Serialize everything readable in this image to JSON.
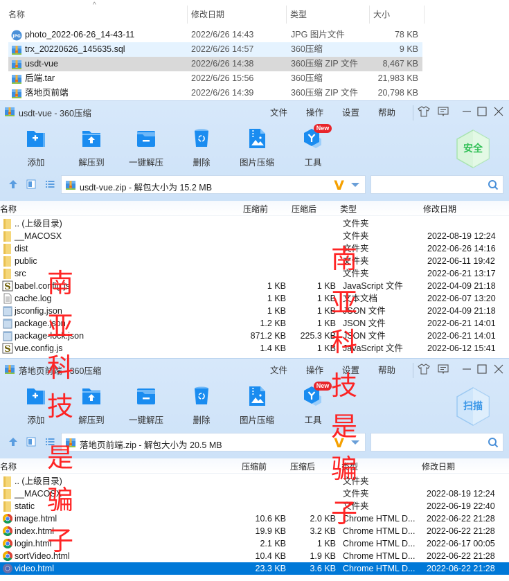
{
  "explorer": {
    "columns": {
      "name": "名称",
      "date": "修改日期",
      "type": "类型",
      "size": "大小"
    },
    "files": [
      {
        "name": "photo_2022-06-26_14-43-11",
        "date": "2022/6/26 14:43",
        "type": "JPG 图片文件",
        "size": "78 KB",
        "icon": "jpg-icon",
        "state": "normal"
      },
      {
        "name": "trx_20220626_145635.sql",
        "date": "2022/6/26 14:57",
        "type": "360压缩",
        "size": "9 KB",
        "icon": "archive-icon",
        "state": "hover"
      },
      {
        "name": "usdt-vue",
        "date": "2022/6/26 14:38",
        "type": "360压缩 ZIP 文件",
        "size": "8,467 KB",
        "icon": "archive-icon",
        "state": "selected"
      },
      {
        "name": "后端.tar",
        "date": "2022/6/26 15:56",
        "type": "360压缩",
        "size": "21,983 KB",
        "icon": "archive-icon",
        "state": "normal"
      },
      {
        "name": "落地页前端",
        "date": "2022/6/26 14:39",
        "type": "360压缩 ZIP 文件",
        "size": "20,798 KB",
        "icon": "archive-icon",
        "state": "normal"
      }
    ]
  },
  "window1": {
    "title": "usdt-vue - 360压缩",
    "menu": [
      "文件",
      "操作",
      "设置",
      "帮助"
    ],
    "toolbar": [
      "添加",
      "解压到",
      "一键解压",
      "删除",
      "图片压缩",
      "工具"
    ],
    "new_badge": "New",
    "shield_label": "安全",
    "address": "usdt-vue.zip - 解包大小为 15.2 MB",
    "search_value": "",
    "columns": {
      "name": "名称",
      "before": "压缩前",
      "after": "压缩后",
      "type": "类型",
      "date": "修改日期"
    },
    "rows": [
      {
        "name": ".. (上级目录)",
        "before": "",
        "after": "",
        "type": "文件夹",
        "date": "",
        "icon": "folder-icon"
      },
      {
        "name": "__MACOSX",
        "before": "",
        "after": "",
        "type": "文件夹",
        "date": "2022-08-19 12:24",
        "icon": "folder-icon"
      },
      {
        "name": "dist",
        "before": "",
        "after": "",
        "type": "文件夹",
        "date": "2022-06-26 14:16",
        "icon": "folder-icon"
      },
      {
        "name": "public",
        "before": "",
        "after": "",
        "type": "文件夹",
        "date": "2022-06-11 19:42",
        "icon": "folder-icon"
      },
      {
        "name": "src",
        "before": "",
        "after": "",
        "type": "文件夹",
        "date": "2022-06-21 13:17",
        "icon": "folder-icon"
      },
      {
        "name": "babel.config.js",
        "before": "1 KB",
        "after": "1 KB",
        "type": "JavaScript 文件",
        "date": "2022-04-09 21:18",
        "icon": "js-icon"
      },
      {
        "name": "cache.log",
        "before": "1 KB",
        "after": "1 KB",
        "type": "文本文档",
        "date": "2022-06-07 13:20",
        "icon": "text-file-icon"
      },
      {
        "name": "jsconfig.json",
        "before": "1 KB",
        "after": "1 KB",
        "type": "JSON 文件",
        "date": "2022-04-09 21:18",
        "icon": "json-icon"
      },
      {
        "name": "package.json",
        "before": "1.2 KB",
        "after": "1 KB",
        "type": "JSON 文件",
        "date": "2022-06-21 14:01",
        "icon": "json-icon"
      },
      {
        "name": "package-lock.json",
        "before": "871.2 KB",
        "after": "225.3 KB",
        "type": "JSON 文件",
        "date": "2022-06-21 14:01",
        "icon": "json-icon"
      },
      {
        "name": "vue.config.js",
        "before": "1.4 KB",
        "after": "1 KB",
        "type": "JavaScript 文件",
        "date": "2022-06-12 15:41",
        "icon": "js-icon"
      }
    ]
  },
  "window2": {
    "title": "落地页前端 - 360压缩",
    "menu": [
      "文件",
      "操作",
      "设置",
      "帮助"
    ],
    "toolbar": [
      "添加",
      "解压到",
      "一键解压",
      "删除",
      "图片压缩",
      "工具"
    ],
    "new_badge": "New",
    "shield_label": "扫描",
    "address": "落地页前端.zip - 解包大小为 20.5 MB",
    "search_value": "",
    "columns": {
      "name": "名称",
      "before": "压缩前",
      "after": "压缩后",
      "type": "类型",
      "date": "修改日期"
    },
    "rows": [
      {
        "name": ".. (上级目录)",
        "before": "",
        "after": "",
        "type": "文件夹",
        "date": "",
        "icon": "folder-icon"
      },
      {
        "name": "__MACOSX",
        "before": "",
        "after": "",
        "type": "文件夹",
        "date": "2022-08-19 12:24",
        "icon": "folder-icon"
      },
      {
        "name": "static",
        "before": "",
        "after": "",
        "type": "文件夹",
        "date": "2022-06-19 22:40",
        "icon": "folder-icon"
      },
      {
        "name": "image.html",
        "before": "10.6 KB",
        "after": "2.0 KB",
        "type": "Chrome HTML D...",
        "date": "2022-06-22 21:28",
        "icon": "chrome-icon"
      },
      {
        "name": "index.html",
        "before": "19.9 KB",
        "after": "3.2 KB",
        "type": "Chrome HTML D...",
        "date": "2022-06-22 21:28",
        "icon": "chrome-icon"
      },
      {
        "name": "login.html",
        "before": "2.1 KB",
        "after": "1 KB",
        "type": "Chrome HTML D...",
        "date": "2022-06-17 00:05",
        "icon": "chrome-icon"
      },
      {
        "name": "sortVideo.html",
        "before": "10.4 KB",
        "after": "1.9 KB",
        "type": "Chrome HTML D...",
        "date": "2022-06-22 21:28",
        "icon": "chrome-icon"
      },
      {
        "name": "video.html",
        "before": "23.3 KB",
        "after": "3.6 KB",
        "type": "Chrome HTML D...",
        "date": "2022-06-22 21:28",
        "icon": "chrome-icon",
        "selected": true
      }
    ]
  },
  "watermark": {
    "text": [
      "南",
      "亚",
      "科",
      "技",
      "是",
      "骗",
      "子"
    ],
    "color": "#ff1a1a"
  }
}
